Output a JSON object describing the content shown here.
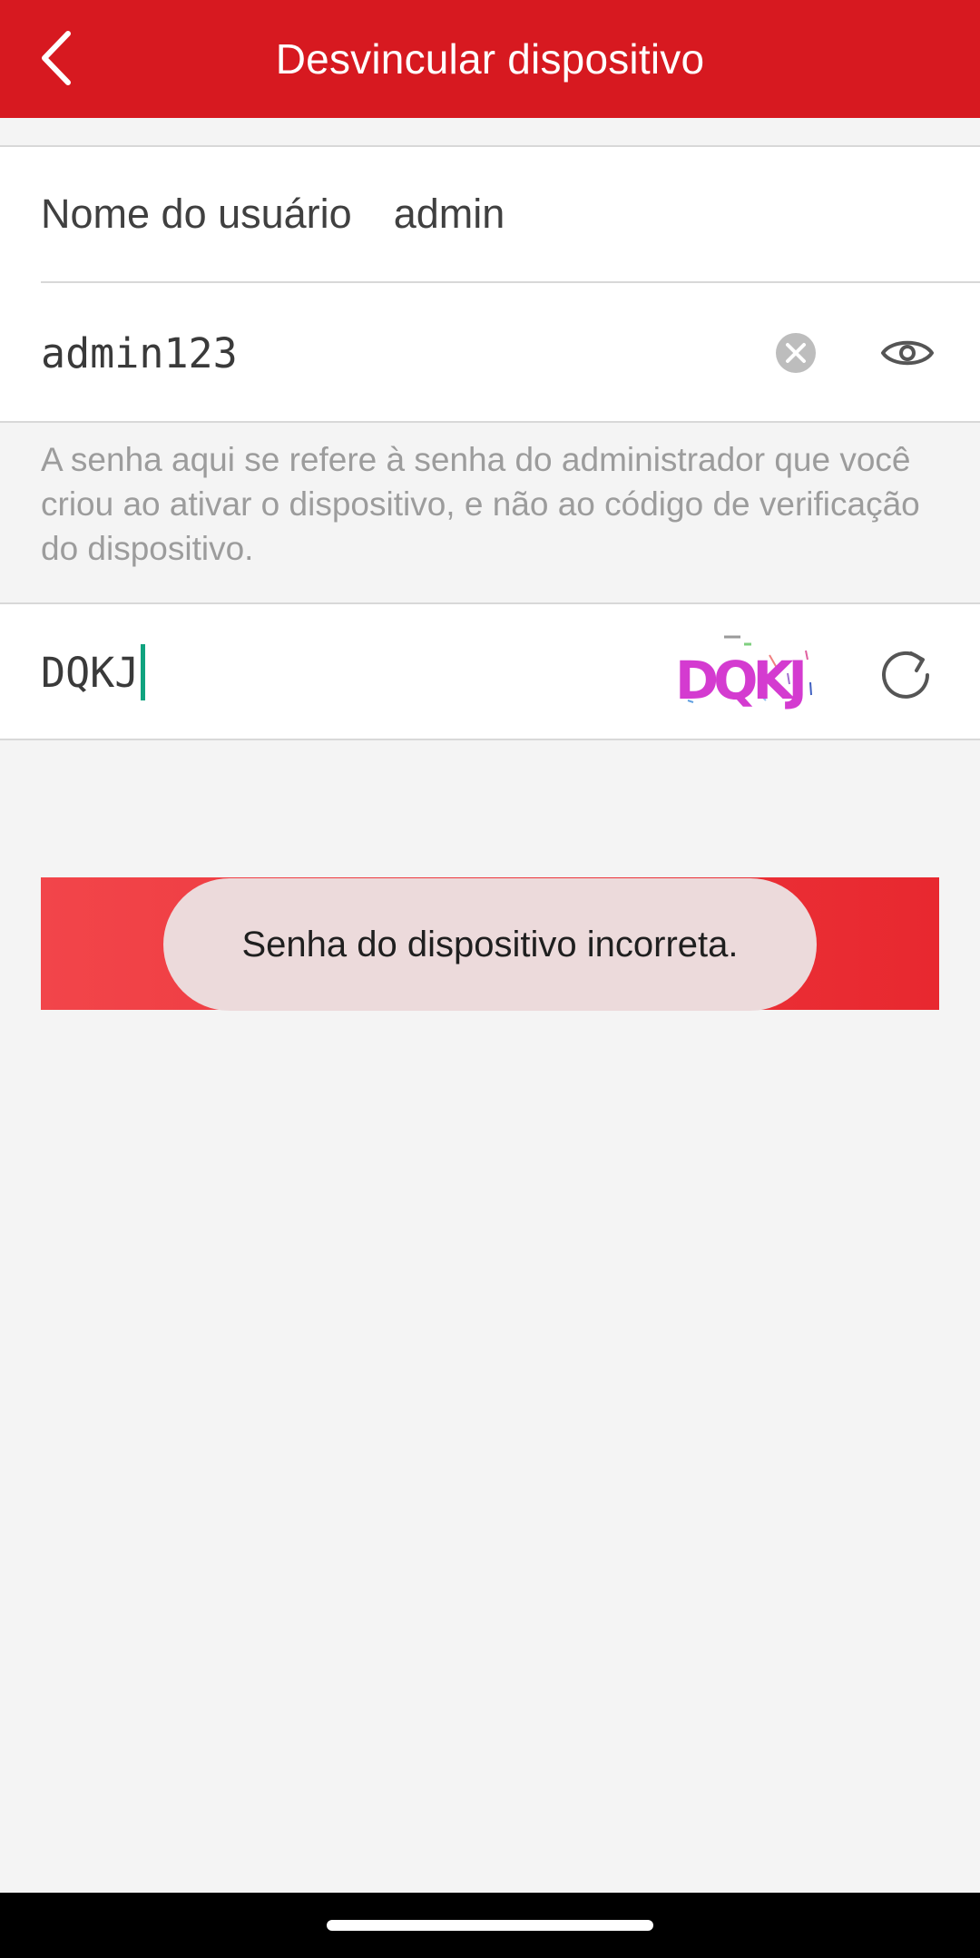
{
  "header": {
    "title": "Desvincular dispositivo"
  },
  "form": {
    "username_label": "Nome do usuário",
    "username_value": "admin",
    "password_value": "admin123",
    "hint": "A senha aqui se refere à senha do administrador que você criou ao ativar o dispositivo, e não ao código de verificação do dispositivo.",
    "captcha_value": "DQKJ",
    "captcha_image_text": "DQKJ"
  },
  "toast": {
    "message": "Senha do dispositivo incorreta."
  },
  "icons": {
    "back": "chevron-left-icon",
    "clear": "clear-icon",
    "visibility": "eye-icon",
    "refresh": "refresh-icon"
  },
  "colors": {
    "header": "#d71920",
    "button": "#e8282f",
    "toast_bg": "#ecdadb",
    "cursor": "#10a37f"
  }
}
